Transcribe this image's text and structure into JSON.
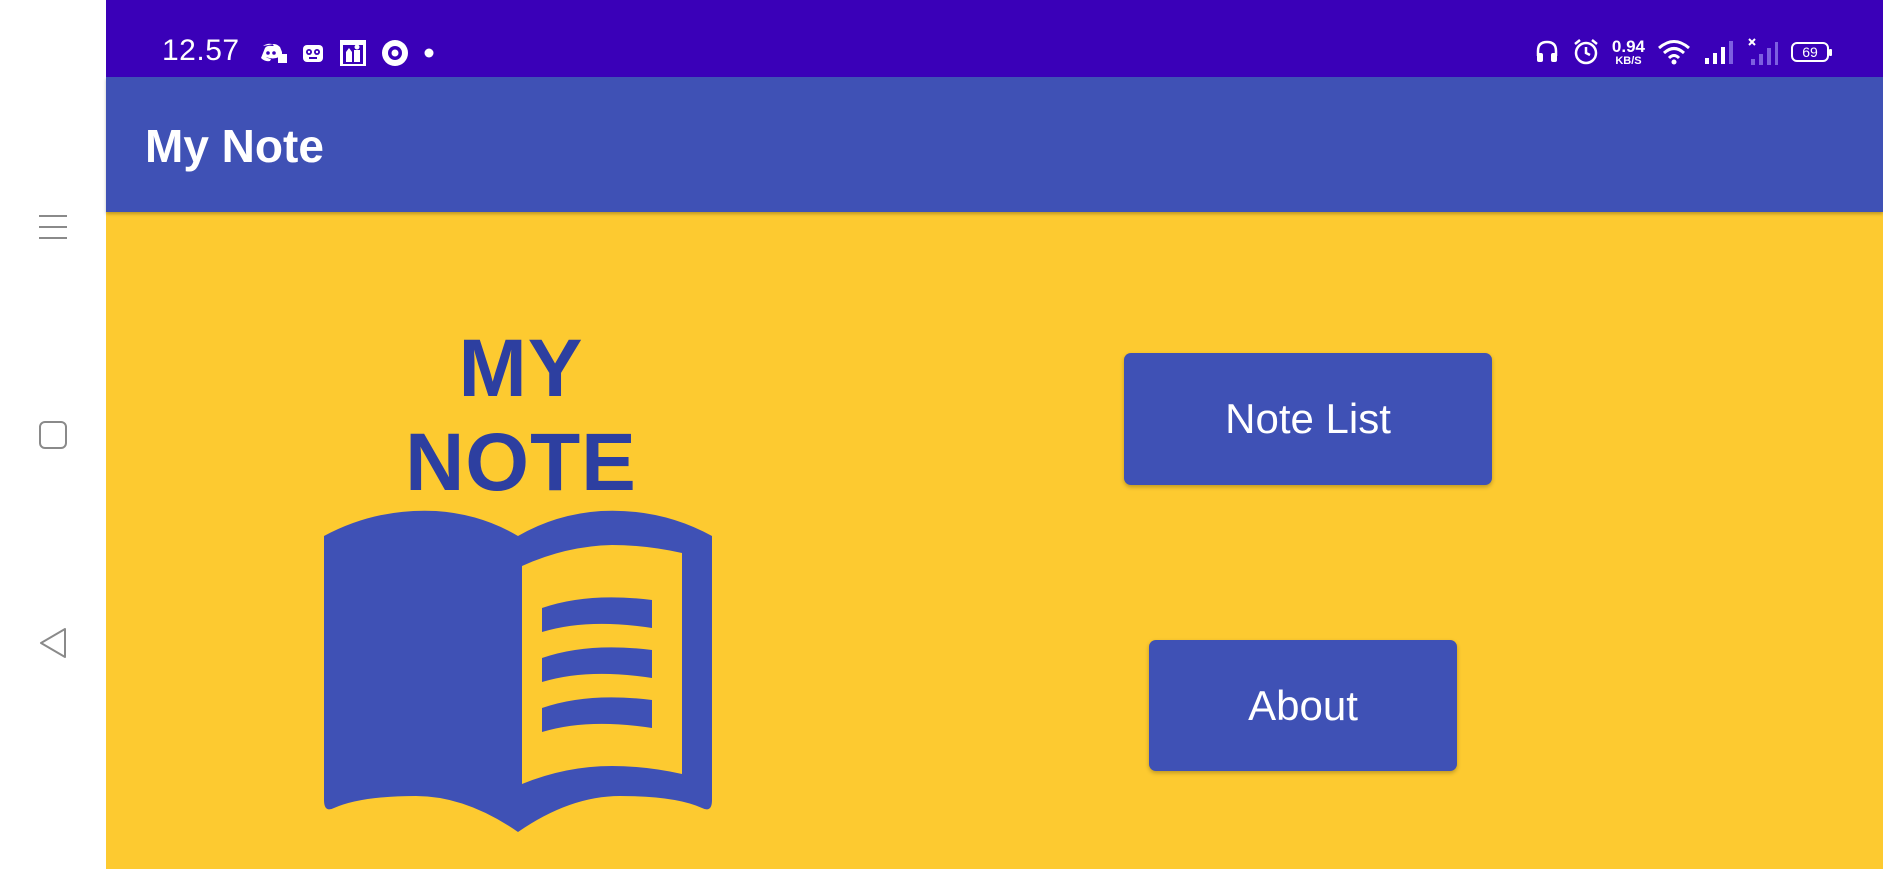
{
  "status_bar": {
    "time": "12.57",
    "left_icons": [
      "discord-icon",
      "game-controller-icon",
      "calendar-app-icon",
      "target-app-icon",
      "notification-dot-icon"
    ],
    "network_speed_value": "0.94",
    "network_speed_unit": "KB/S",
    "battery_level": "69",
    "right_icons": [
      "headphones-icon",
      "alarm-icon",
      "wifi-icon",
      "signal-icon",
      "no-signal-icon",
      "battery-icon"
    ]
  },
  "app_bar": {
    "title": "My Note"
  },
  "main": {
    "hero_title": "MY NOTE",
    "illustration": "open-book-icon",
    "buttons": {
      "note_list": "Note List",
      "about": "About"
    }
  },
  "navigation": {
    "items": [
      "menu-icon",
      "home-icon",
      "back-icon"
    ]
  },
  "colors": {
    "status_bar": "#3a00b8",
    "app_bar": "#3f51b5",
    "background": "#fdca30",
    "primary": "#3f51b5",
    "hero_text": "#2d3fa0"
  }
}
